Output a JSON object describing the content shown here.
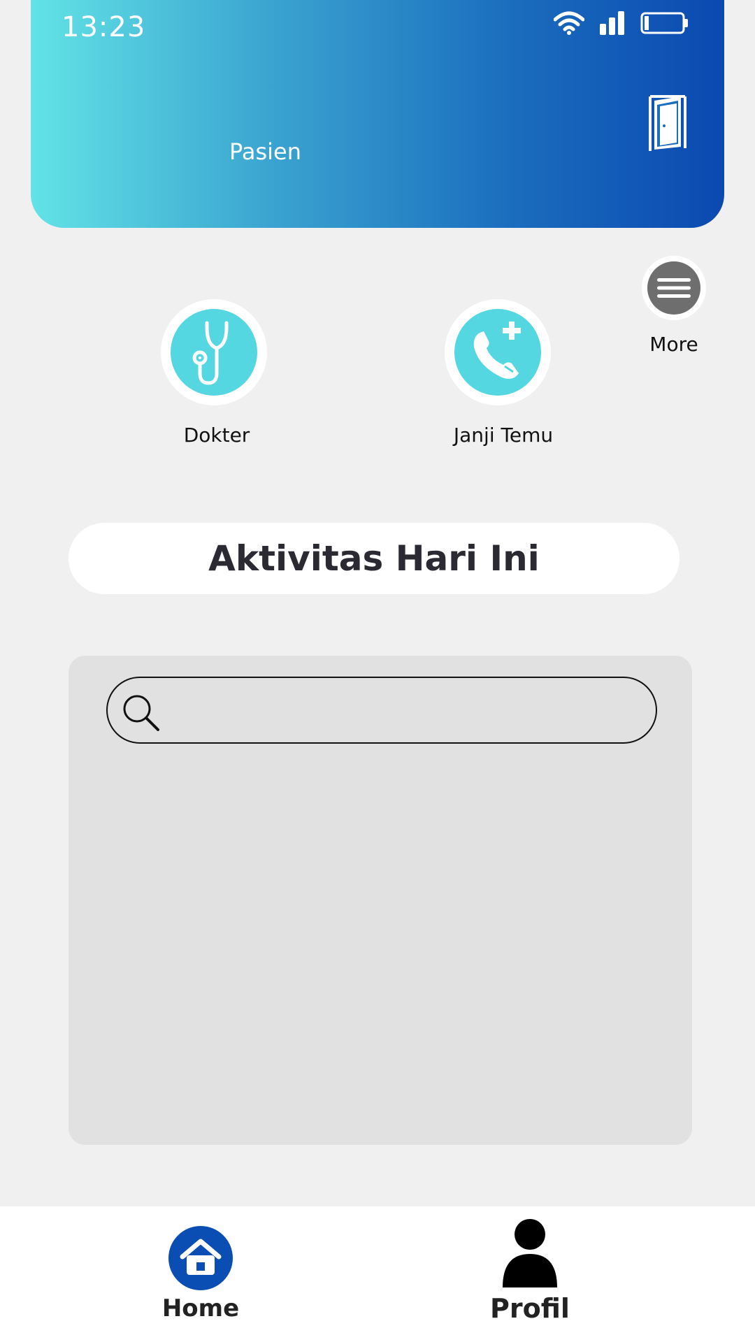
{
  "status_bar": {
    "time": "13:23"
  },
  "header": {
    "role": "Pasien"
  },
  "menu": {
    "items": [
      {
        "label": "Dokter",
        "icon": "stethoscope-icon"
      },
      {
        "label": "Janji Temu",
        "icon": "phone-plus-icon"
      }
    ],
    "more_label": "More"
  },
  "activity": {
    "title": "Aktivitas Hari Ini"
  },
  "search": {
    "placeholder": "",
    "value": ""
  },
  "bottom_nav": {
    "home_label": "Home",
    "profile_label": "Profil"
  },
  "colors": {
    "accent": "#55d7e1",
    "brand_dark": "#0b49b1",
    "home_active": "#0a4db3"
  }
}
